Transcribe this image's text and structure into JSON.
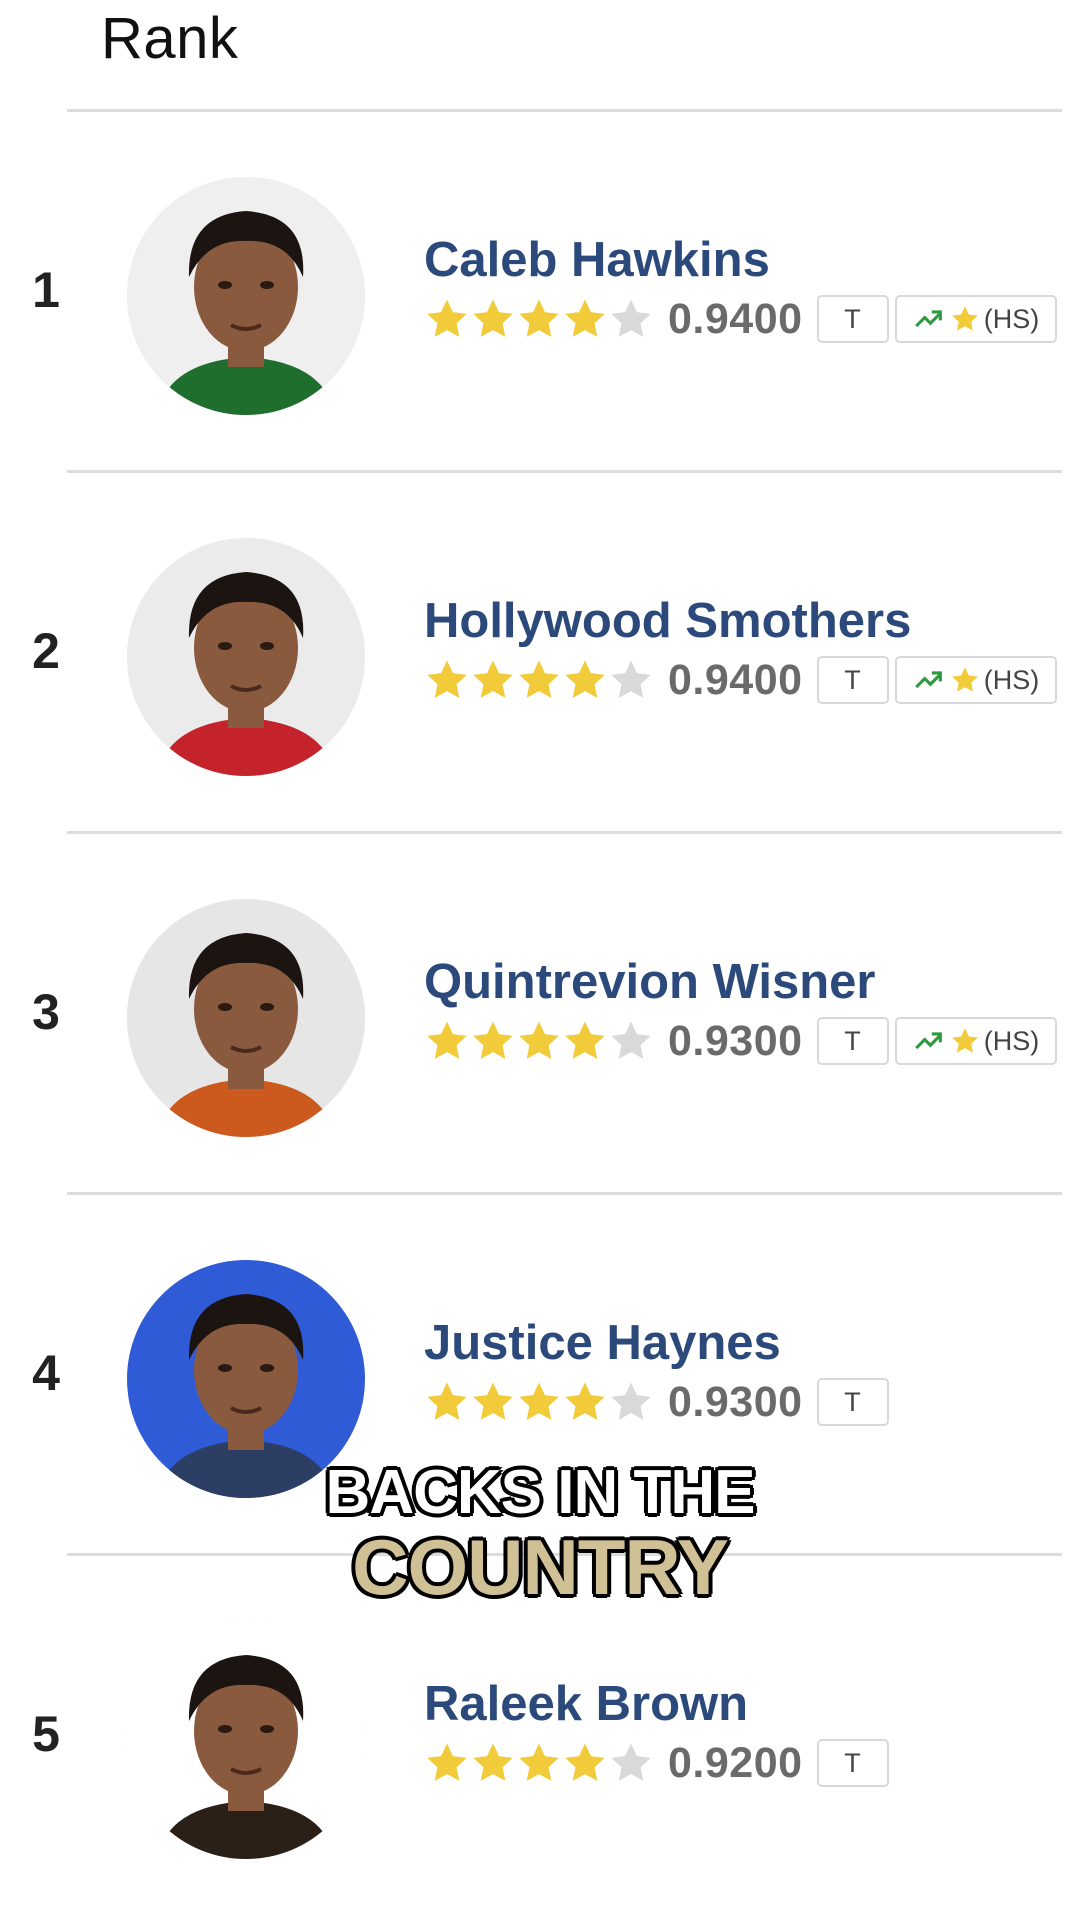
{
  "header": {
    "title": "Rank"
  },
  "players": [
    {
      "rank": "1",
      "name": "Caleb Hawkins",
      "stars": 4,
      "max_stars": 5,
      "score": "0.9400",
      "badge_t": "T",
      "hs_badge": true,
      "hs_label": "(HS)",
      "jersey_color": "#1f6e2e"
    },
    {
      "rank": "2",
      "name": "Hollywood Smothers",
      "stars": 4,
      "max_stars": 5,
      "score": "0.9400",
      "badge_t": "T",
      "hs_badge": true,
      "hs_label": "(HS)",
      "jersey_color": "#c4232b"
    },
    {
      "rank": "3",
      "name": "Quintrevion Wisner",
      "stars": 4,
      "max_stars": 5,
      "score": "0.9300",
      "badge_t": "T",
      "hs_badge": true,
      "hs_label": "(HS)",
      "jersey_color": "#cc5a1e"
    },
    {
      "rank": "4",
      "name": "Justice Haynes",
      "stars": 4,
      "max_stars": 5,
      "score": "0.9300",
      "badge_t": "T",
      "hs_badge": false,
      "hs_label": "",
      "jersey_color": "#2c3e63"
    },
    {
      "rank": "5",
      "name": "Raleek Brown",
      "stars": 4,
      "max_stars": 5,
      "score": "0.9200",
      "badge_t": "T",
      "hs_badge": false,
      "hs_label": "",
      "jersey_color": "#2a2018"
    }
  ],
  "caption": {
    "line1": "BACKS IN THE",
    "line2": "COUNTRY",
    "line2_color": "#cfc096"
  },
  "colors": {
    "star_filled": "#f1cb3a",
    "star_empty": "#d9d9d9",
    "name": "#2b4a7b",
    "trend_arrow": "#2e9a3f"
  },
  "icons": {
    "star": "star-icon",
    "trend": "trending-up-icon"
  }
}
